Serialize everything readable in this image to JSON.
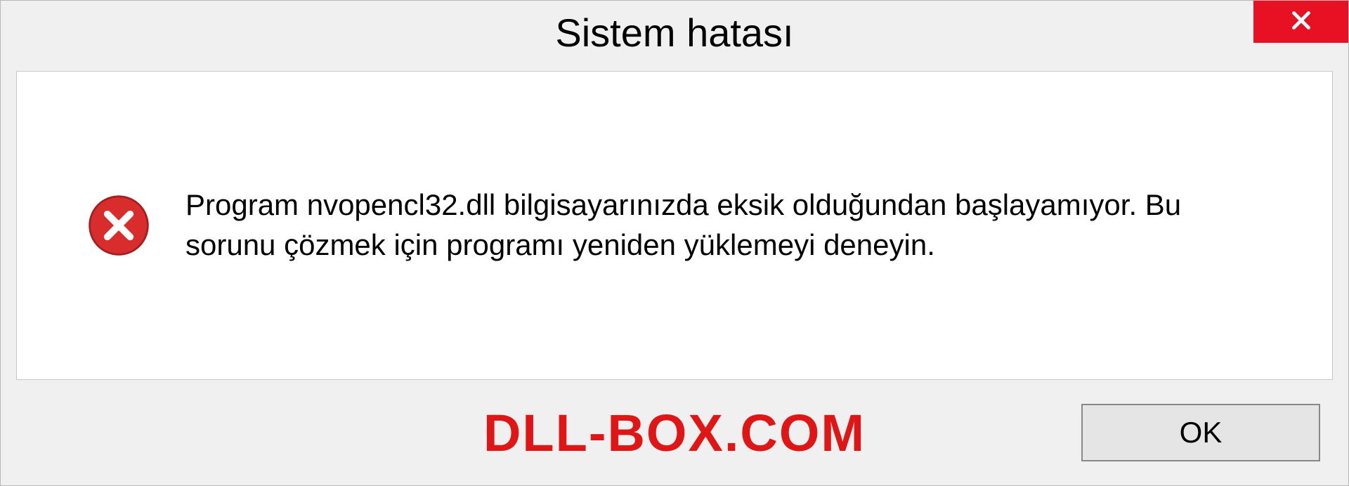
{
  "dialog": {
    "title": "Sistem hatası",
    "message": "Program nvopencl32.dll bilgisayarınızda eksik olduğundan başlayamıyor. Bu sorunu çözmek için programı yeniden yüklemeyi deneyin.",
    "ok_label": "OK"
  },
  "watermark": "DLL-BOX.COM",
  "colors": {
    "close_bg": "#e81123",
    "error_icon": "#d92c2c",
    "watermark": "#e01616"
  }
}
